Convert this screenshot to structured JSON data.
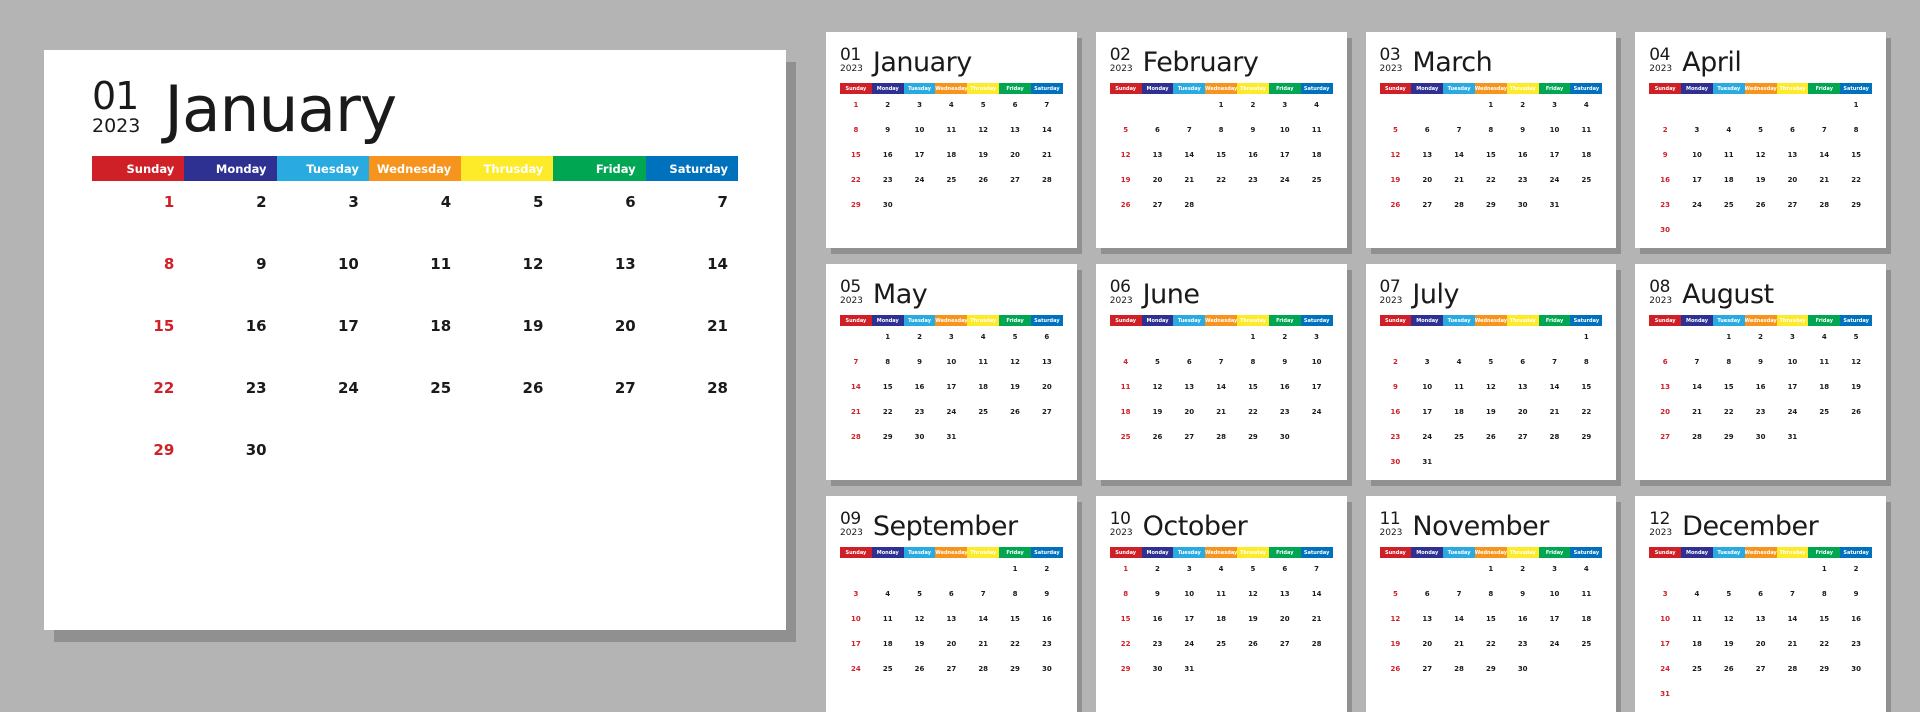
{
  "colors": {
    "background": "#b4b4b4",
    "card": "#ffffff",
    "sunday": "#cf2027",
    "monday": "#2e3192",
    "tuesday": "#29abe2",
    "wednesday": "#f7941e",
    "thursday": "#fdeb2a",
    "friday": "#00a651",
    "saturday": "#0071bc",
    "text": "#1a1a1a",
    "sunday_date_text": "#cf2027"
  },
  "weekdays": [
    {
      "key": "sunday",
      "label": "Sunday",
      "color": "#cf2027"
    },
    {
      "key": "monday",
      "label": "Monday",
      "color": "#2e3192"
    },
    {
      "key": "tuesday",
      "label": "Tuesday",
      "color": "#29abe2"
    },
    {
      "key": "wednesday",
      "label": "Wednesday",
      "color": "#f7941e"
    },
    {
      "key": "thursday",
      "label": "Thrusday",
      "color": "#fdeb2a"
    },
    {
      "key": "friday",
      "label": "Friday",
      "color": "#00a651"
    },
    {
      "key": "saturday",
      "label": "Saturday",
      "color": "#0071bc"
    }
  ],
  "year": "2023",
  "featured": {
    "month_number": "01",
    "year": "2023",
    "month_name": "January",
    "lead_blanks": 0,
    "days": [
      1,
      2,
      3,
      4,
      5,
      6,
      7,
      8,
      9,
      10,
      11,
      12,
      13,
      14,
      15,
      16,
      17,
      18,
      19,
      20,
      21,
      22,
      23,
      24,
      25,
      26,
      27,
      28,
      29,
      30
    ],
    "rows": 5
  },
  "months": [
    {
      "month_number": "01",
      "year": "2023",
      "name": "January",
      "lead_blanks": 0,
      "days": [
        1,
        2,
        3,
        4,
        5,
        6,
        7,
        8,
        9,
        10,
        11,
        12,
        13,
        14,
        15,
        16,
        17,
        18,
        19,
        20,
        21,
        22,
        23,
        24,
        25,
        26,
        27,
        28,
        29,
        30
      ],
      "rows": 5
    },
    {
      "month_number": "02",
      "year": "2023",
      "name": "February",
      "lead_blanks": 3,
      "days": [
        1,
        2,
        3,
        4,
        5,
        6,
        7,
        8,
        9,
        10,
        11,
        12,
        13,
        14,
        15,
        16,
        17,
        18,
        19,
        20,
        21,
        22,
        23,
        24,
        25,
        26,
        27,
        28
      ],
      "rows": 5
    },
    {
      "month_number": "03",
      "year": "2023",
      "name": "March",
      "lead_blanks": 3,
      "days": [
        1,
        2,
        3,
        4,
        5,
        6,
        7,
        8,
        9,
        10,
        11,
        12,
        13,
        14,
        15,
        16,
        17,
        18,
        19,
        20,
        21,
        22,
        23,
        24,
        25,
        26,
        27,
        28,
        29,
        30,
        31
      ],
      "rows": 5
    },
    {
      "month_number": "04",
      "year": "2023",
      "name": "April",
      "lead_blanks": 6,
      "days": [
        1,
        2,
        3,
        4,
        5,
        6,
        7,
        8,
        9,
        10,
        11,
        12,
        13,
        14,
        15,
        16,
        17,
        18,
        19,
        20,
        21,
        22,
        23,
        24,
        25,
        26,
        27,
        28,
        29,
        30
      ],
      "rows": 6
    },
    {
      "month_number": "05",
      "year": "2023",
      "name": "May",
      "lead_blanks": 1,
      "days": [
        1,
        2,
        3,
        4,
        5,
        6,
        7,
        8,
        9,
        10,
        11,
        12,
        13,
        14,
        15,
        16,
        17,
        18,
        19,
        20,
        21,
        22,
        23,
        24,
        25,
        26,
        27,
        28,
        29,
        30,
        31
      ],
      "rows": 5
    },
    {
      "month_number": "06",
      "year": "2023",
      "name": "June",
      "lead_blanks": 4,
      "days": [
        1,
        2,
        3,
        4,
        5,
        6,
        7,
        8,
        9,
        10,
        11,
        12,
        13,
        14,
        15,
        16,
        17,
        18,
        19,
        20,
        21,
        22,
        23,
        24,
        25,
        26,
        27,
        28,
        29,
        30
      ],
      "rows": 5
    },
    {
      "month_number": "07",
      "year": "2023",
      "name": "July",
      "lead_blanks": 6,
      "days": [
        1,
        2,
        3,
        4,
        5,
        6,
        7,
        8,
        9,
        10,
        11,
        12,
        13,
        14,
        15,
        16,
        17,
        18,
        19,
        20,
        21,
        22,
        23,
        24,
        25,
        26,
        27,
        28,
        29,
        30,
        31
      ],
      "rows": 6
    },
    {
      "month_number": "08",
      "year": "2023",
      "name": "August",
      "lead_blanks": 2,
      "days": [
        1,
        2,
        3,
        4,
        5,
        6,
        7,
        8,
        9,
        10,
        11,
        12,
        13,
        14,
        15,
        16,
        17,
        18,
        19,
        20,
        21,
        22,
        23,
        24,
        25,
        26,
        27,
        28,
        29,
        30,
        31
      ],
      "rows": 5
    },
    {
      "month_number": "09",
      "year": "2023",
      "name": "September",
      "lead_blanks": 5,
      "days": [
        1,
        2,
        3,
        4,
        5,
        6,
        7,
        8,
        9,
        10,
        11,
        12,
        13,
        14,
        15,
        16,
        17,
        18,
        19,
        20,
        21,
        22,
        23,
        24,
        25,
        26,
        27,
        28,
        29,
        30
      ],
      "rows": 5
    },
    {
      "month_number": "10",
      "year": "2023",
      "name": "October",
      "lead_blanks": 0,
      "days": [
        1,
        2,
        3,
        4,
        5,
        6,
        7,
        8,
        9,
        10,
        11,
        12,
        13,
        14,
        15,
        16,
        17,
        18,
        19,
        20,
        21,
        22,
        23,
        24,
        25,
        26,
        27,
        28,
        29,
        30,
        31
      ],
      "rows": 5
    },
    {
      "month_number": "11",
      "year": "2023",
      "name": "November",
      "lead_blanks": 3,
      "days": [
        1,
        2,
        3,
        4,
        5,
        6,
        7,
        8,
        9,
        10,
        11,
        12,
        13,
        14,
        15,
        16,
        17,
        18,
        19,
        20,
        21,
        22,
        23,
        24,
        25,
        26,
        27,
        28,
        29,
        30
      ],
      "rows": 5
    },
    {
      "month_number": "12",
      "year": "2023",
      "name": "December",
      "lead_blanks": 5,
      "days": [
        1,
        2,
        3,
        4,
        5,
        6,
        7,
        8,
        9,
        10,
        11,
        12,
        13,
        14,
        15,
        16,
        17,
        18,
        19,
        20,
        21,
        22,
        23,
        24,
        25,
        26,
        27,
        28,
        29,
        30,
        31
      ],
      "rows": 6
    }
  ]
}
